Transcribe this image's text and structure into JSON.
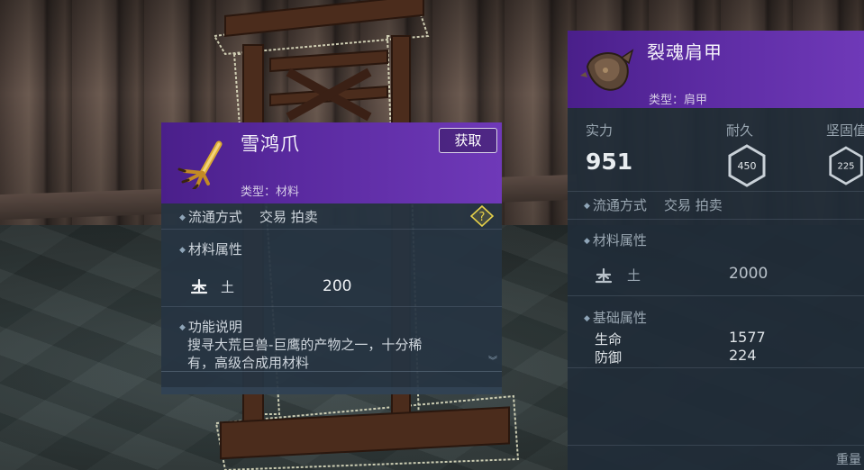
{
  "left_item": {
    "name": "雪鸿爪",
    "type_label": "类型：材料",
    "obtain_button": "获取",
    "circulation_label": "流通方式",
    "circulation_value": "交易 拍卖",
    "help_glyph": "?",
    "material_section": "材料属性",
    "element_name": "土",
    "element_value": "200",
    "function_section": "功能说明",
    "description_line1": "搜寻大荒巨兽-巨鹰的产物之一，十分稀",
    "description_line2": "有，高级合成用材料"
  },
  "right_item": {
    "name": "裂魂肩甲",
    "type_label": "类型：肩甲",
    "power_label": "实力",
    "power_value": "951",
    "durability_label": "耐久",
    "durability_value": "450",
    "hardness_label": "坚固值",
    "hardness_value": "225",
    "circulation_label": "流通方式",
    "circulation_value": "交易 拍卖",
    "material_section": "材料属性",
    "element_name": "土",
    "element_value": "2000",
    "base_section": "基础属性",
    "stats": [
      {
        "name": "生命",
        "value": "1577"
      },
      {
        "name": "防御",
        "value": "224"
      }
    ],
    "weight_label": "重量"
  },
  "colors": {
    "header_purple": "#5a2aa0",
    "panel_bg": "#263442",
    "help_yellow": "#e8d24a"
  }
}
